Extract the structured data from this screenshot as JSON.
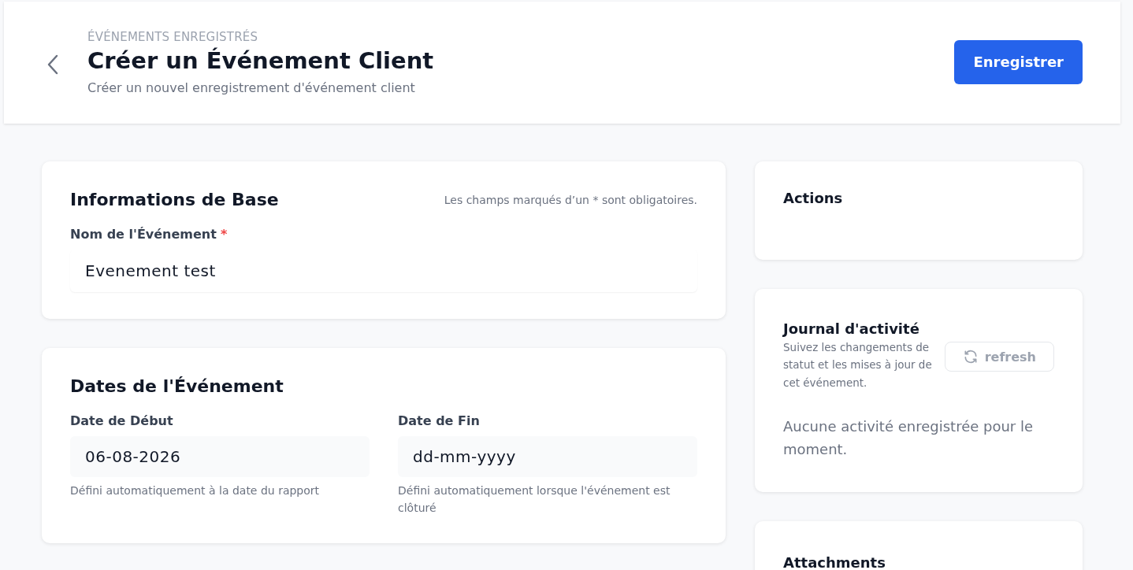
{
  "header": {
    "breadcrumb": "ÉVÉNEMENTS ENREGISTRÉS",
    "title": "Créer un Événement Client",
    "subtitle": "Créer un nouvel enregistrement d'événement client",
    "save_button": "Enregistrer"
  },
  "basic_info": {
    "title": "Informations de Base",
    "required_note": "Les champs marqués d’un * sont obligatoires.",
    "fields": [
      {
        "label": "Nom de l'Événement",
        "required": true,
        "required_mark": "*",
        "value": "Evenement test"
      }
    ]
  },
  "dates": {
    "title": "Dates de l'Événement",
    "fields": [
      {
        "label": "Date de Début",
        "value": "06-08-2026",
        "help": "Défini automatiquement à la date du rapport"
      },
      {
        "label": "Date de Fin",
        "placeholder": "dd-mm-yyyy",
        "help": "Défini automatiquement lorsque l'événement est clôturé"
      }
    ]
  },
  "actions": {
    "title": "Actions"
  },
  "activity_log": {
    "title": "Journal d'activité",
    "description": "Suivez les changements de statut et les mises à jour de cet événement.",
    "refresh_button": {
      "label": "refresh",
      "disabled": true
    },
    "empty_message": "Aucune activité enregistrée pour le moment."
  },
  "attachments": {
    "title": "Attachments"
  }
}
